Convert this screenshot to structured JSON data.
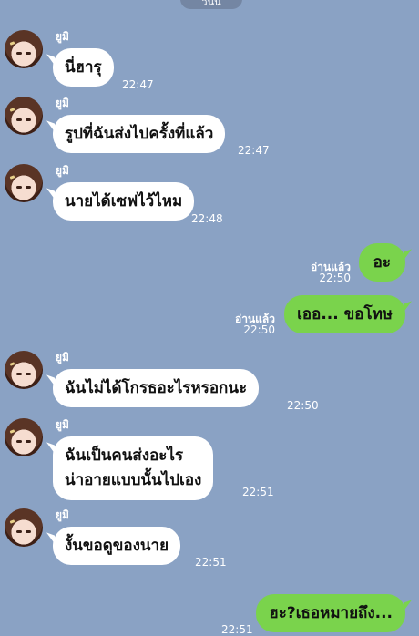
{
  "header": {
    "date": "วันนี้"
  },
  "messages": [
    {
      "sender": "ยูมิ",
      "text": "นี่ฮารุ",
      "time": "22:47"
    },
    {
      "sender": "ยูมิ",
      "text": "รูปที่ฉันส่งไปครั้งที่แล้ว",
      "time": "22:47"
    },
    {
      "sender": "ยูมิ",
      "text": "นายได้เซฟไว้ไหม",
      "time": "22:48"
    },
    {
      "read_label": "อ่านแล้ว",
      "text": "อะ",
      "time": "22:50"
    },
    {
      "read_label": "อ่านแล้ว",
      "text": "เออ... ขอโทษ",
      "time": "22:50"
    },
    {
      "sender": "ยูมิ",
      "text": "ฉันไม่ได้โกรธอะไรหรอกนะ",
      "time": "22:50"
    },
    {
      "sender": "ยูมิ",
      "text": "ฉันเป็นคนส่งอะไร",
      "text2": "น่าอายแบบนั้นไปเอง",
      "time": "22:51"
    },
    {
      "sender": "ยูมิ",
      "text": "งั้นขอดูของนาย",
      "time": "22:51"
    },
    {
      "text": "ฮะ?เธอหมายถึง...",
      "time": "22:51"
    }
  ]
}
